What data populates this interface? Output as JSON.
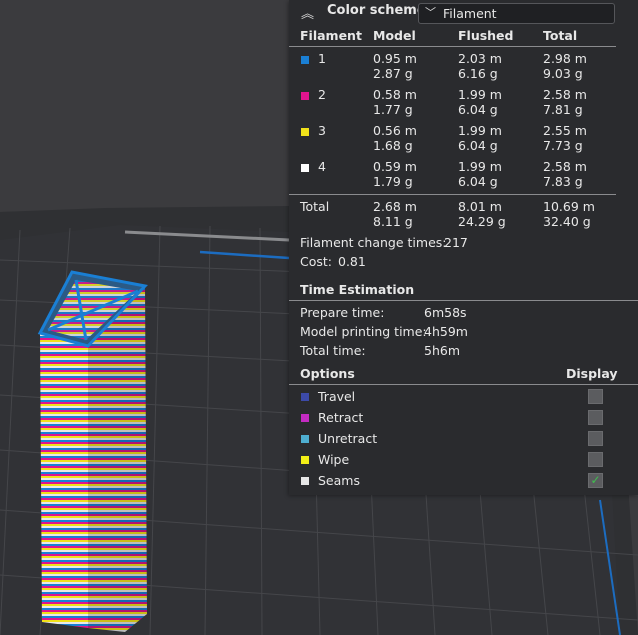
{
  "header": {
    "collapse_icon": "double-chevron-up-icon",
    "title": "Color scheme",
    "scheme_value": "Filament"
  },
  "table": {
    "columns": [
      "Filament",
      "Model",
      "Flushed",
      "Total"
    ],
    "rows": [
      {
        "label": "1",
        "color": "#1a7fd4",
        "model_m": "0.95 m",
        "model_g": "2.87 g",
        "flushed_m": "2.03 m",
        "flushed_g": "6.16 g",
        "total_m": "2.98 m",
        "total_g": "9.03 g"
      },
      {
        "label": "2",
        "color": "#e0148e",
        "model_m": "0.58 m",
        "model_g": "1.77 g",
        "flushed_m": "1.99 m",
        "flushed_g": "6.04 g",
        "total_m": "2.58 m",
        "total_g": "7.81 g"
      },
      {
        "label": "3",
        "color": "#f1e21a",
        "model_m": "0.56 m",
        "model_g": "1.68 g",
        "flushed_m": "1.99 m",
        "flushed_g": "6.04 g",
        "total_m": "2.55 m",
        "total_g": "7.73 g"
      },
      {
        "label": "4",
        "color": "#ffffff",
        "model_m": "0.59 m",
        "model_g": "1.79 g",
        "flushed_m": "1.99 m",
        "flushed_g": "6.04 g",
        "total_m": "2.58 m",
        "total_g": "7.83 g"
      }
    ],
    "total": {
      "label": "Total",
      "model_m": "2.68 m",
      "model_g": "8.11 g",
      "flushed_m": "8.01 m",
      "flushed_g": "24.29 g",
      "total_m": "10.69 m",
      "total_g": "32.40 g"
    }
  },
  "filament_change": {
    "label": "Filament change times:",
    "value": "217"
  },
  "cost": {
    "label": "Cost:",
    "value": "0.81"
  },
  "time": {
    "title": "Time Estimation",
    "items": [
      {
        "label": "Prepare time:",
        "value": "6m58s"
      },
      {
        "label": "Model printing time:",
        "value": "4h59m"
      },
      {
        "label": "Total time:",
        "value": "5h6m"
      }
    ]
  },
  "options": {
    "title": "Options",
    "display_label": "Display",
    "items": [
      {
        "label": "Travel",
        "color": "#3c4aa8",
        "checked": false
      },
      {
        "label": "Retract",
        "color": "#c42bc2",
        "checked": false
      },
      {
        "label": "Unretract",
        "color": "#4eaed0",
        "checked": false
      },
      {
        "label": "Wipe",
        "color": "#f2ee16",
        "checked": false
      },
      {
        "label": "Seams",
        "color": "#e6e6e6",
        "checked": true
      }
    ],
    "check_mark": "✓"
  },
  "scene": {
    "tower_colors": [
      "#1a7fd4",
      "#e0148e",
      "#f1e21a",
      "#ffffff"
    ]
  }
}
